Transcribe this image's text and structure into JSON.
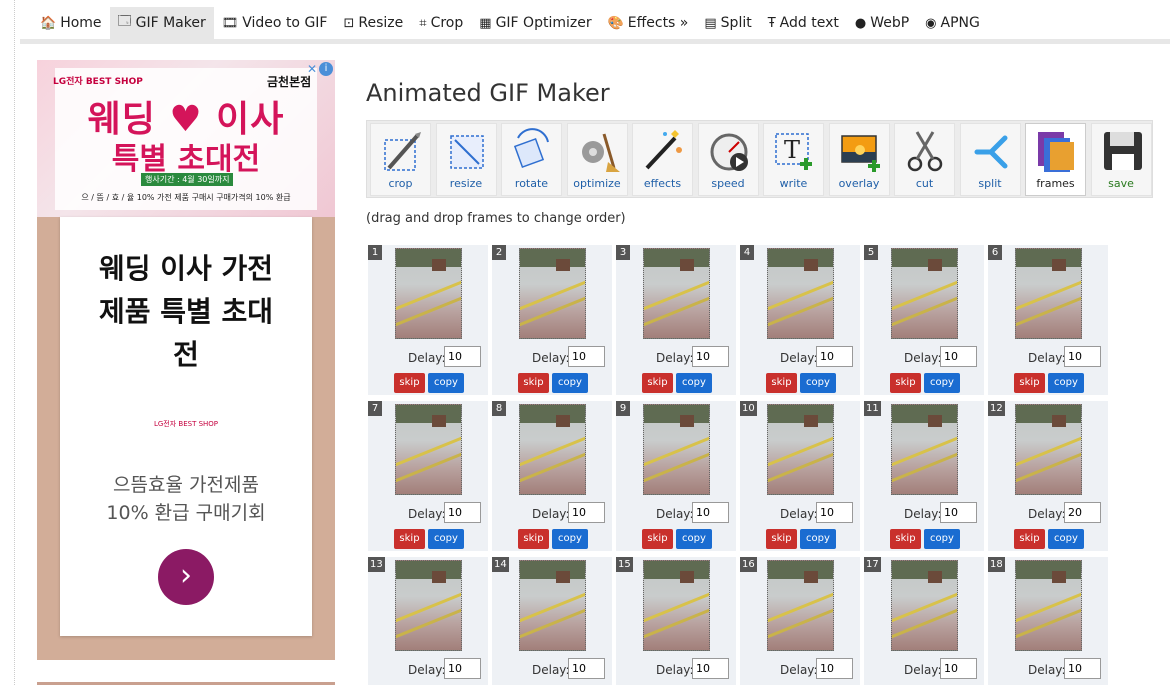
{
  "nav": [
    {
      "label": "Home",
      "icon": "home-icon",
      "glyph": "🏠",
      "active": false
    },
    {
      "label": "GIF Maker",
      "icon": "gif-maker-icon",
      "glyph": "🗔",
      "active": true
    },
    {
      "label": "Video to GIF",
      "icon": "film-icon",
      "glyph": "🎞",
      "active": false
    },
    {
      "label": "Resize",
      "icon": "resize-icon",
      "glyph": "⊡",
      "active": false
    },
    {
      "label": "Crop",
      "icon": "crop-icon",
      "glyph": "⌗",
      "active": false
    },
    {
      "label": "GIF Optimizer",
      "icon": "optimizer-icon",
      "glyph": "▦",
      "active": false
    },
    {
      "label": "Effects »",
      "icon": "palette-icon",
      "glyph": "🎨",
      "active": false
    },
    {
      "label": "Split",
      "icon": "split-icon",
      "glyph": "▤",
      "active": false
    },
    {
      "label": "Add text",
      "icon": "text-icon",
      "glyph": "Ŧ",
      "active": false
    },
    {
      "label": "WebP",
      "icon": "webp-icon",
      "glyph": "●",
      "active": false
    },
    {
      "label": "APNG",
      "icon": "apng-icon",
      "glyph": "◉",
      "active": false
    }
  ],
  "ad": {
    "banner_logo": "LG전자  BEST SHOP",
    "banner_store": "금천본점",
    "banner_line1": "웨딩 ♥ 이사",
    "banner_line2": "특별 초대전",
    "banner_period": "행사기간 : 4월 30일까지",
    "banner_small": "으 / 뜸 / 효 / 율 10% 가전 제품 구매시 구매가격의 10% 환급",
    "headline": "웨딩 이사 가전제품 특별 초대전",
    "logo2": "LG전자  BEST SHOP",
    "sub": "으뜸효율 가전제품 10% 환급 구매기회",
    "cta": "›"
  },
  "page": {
    "title": "Animated GIF Maker",
    "hint": "(drag and drop frames to change order)"
  },
  "tools": [
    {
      "label": "crop",
      "icon": "crop-tool-icon"
    },
    {
      "label": "resize",
      "icon": "resize-tool-icon"
    },
    {
      "label": "rotate",
      "icon": "rotate-tool-icon"
    },
    {
      "label": "optimize",
      "icon": "optimize-tool-icon"
    },
    {
      "label": "effects",
      "icon": "effects-tool-icon"
    },
    {
      "label": "speed",
      "icon": "speed-tool-icon"
    },
    {
      "label": "write",
      "icon": "write-tool-icon"
    },
    {
      "label": "overlay",
      "icon": "overlay-tool-icon"
    },
    {
      "label": "cut",
      "icon": "scissors-icon"
    },
    {
      "label": "split",
      "icon": "split-tool-icon"
    },
    {
      "label": "frames",
      "icon": "frames-tool-icon",
      "active": true
    },
    {
      "label": "save",
      "icon": "floppy-disk-icon"
    }
  ],
  "frame_labels": {
    "delay": "Delay:",
    "skip": "skip",
    "copy": "copy"
  },
  "frames": [
    {
      "num": "1",
      "delay": "10"
    },
    {
      "num": "2",
      "delay": "10"
    },
    {
      "num": "3",
      "delay": "10"
    },
    {
      "num": "4",
      "delay": "10"
    },
    {
      "num": "5",
      "delay": "10"
    },
    {
      "num": "6",
      "delay": "10"
    },
    {
      "num": "7",
      "delay": "10"
    },
    {
      "num": "8",
      "delay": "10"
    },
    {
      "num": "9",
      "delay": "10"
    },
    {
      "num": "10",
      "delay": "10"
    },
    {
      "num": "11",
      "delay": "10"
    },
    {
      "num": "12",
      "delay": "20"
    },
    {
      "num": "13",
      "delay": "10"
    },
    {
      "num": "14",
      "delay": "10"
    },
    {
      "num": "15",
      "delay": "10"
    },
    {
      "num": "16",
      "delay": "10"
    },
    {
      "num": "17",
      "delay": "10"
    },
    {
      "num": "18",
      "delay": "10"
    }
  ],
  "colors": {
    "skip": "#c9302c",
    "copy": "#1a6cd1",
    "ad_button": "#8b1a64",
    "ad_pink": "#d4145a"
  }
}
